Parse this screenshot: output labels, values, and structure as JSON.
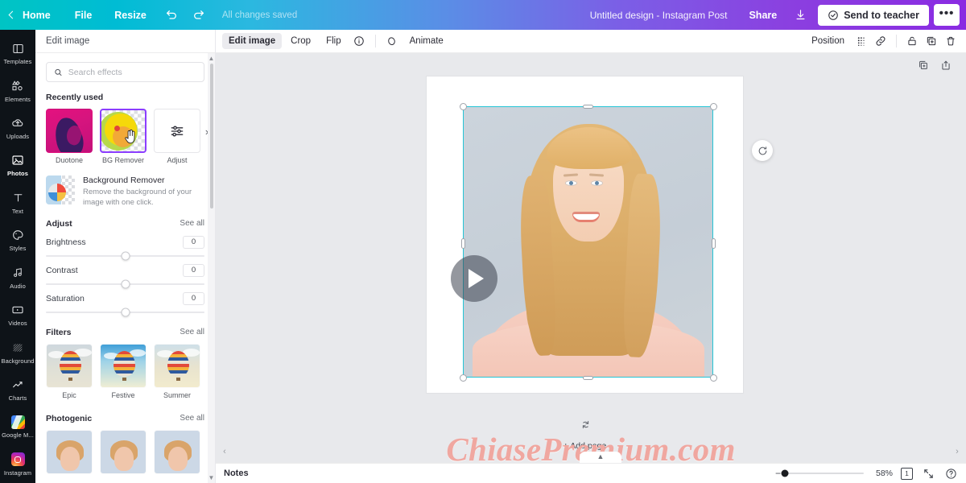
{
  "topbar": {
    "home": "Home",
    "file": "File",
    "resize": "Resize",
    "undo_icon": "undo-icon",
    "redo_icon": "redo-icon",
    "saved_status": "All changes saved",
    "doc_title": "Untitled design - Instagram Post",
    "share": "Share",
    "download_icon": "download-icon",
    "send_to_teacher": "Send to teacher",
    "more": "•••"
  },
  "rail": {
    "items": [
      {
        "label": "Templates",
        "icon": "templates-icon"
      },
      {
        "label": "Elements",
        "icon": "elements-icon"
      },
      {
        "label": "Uploads",
        "icon": "uploads-icon"
      },
      {
        "label": "Photos",
        "icon": "photos-icon",
        "active": true
      },
      {
        "label": "Text",
        "icon": "text-icon"
      },
      {
        "label": "Styles",
        "icon": "styles-icon"
      },
      {
        "label": "Audio",
        "icon": "audio-icon"
      },
      {
        "label": "Videos",
        "icon": "videos-icon"
      },
      {
        "label": "Background",
        "icon": "background-icon"
      },
      {
        "label": "Charts",
        "icon": "charts-icon"
      },
      {
        "label": "Google M...",
        "icon": "google-maps-icon"
      },
      {
        "label": "Instagram",
        "icon": "instagram-icon"
      }
    ]
  },
  "panel": {
    "title": "Edit image",
    "search_placeholder": "Search effects",
    "recently_used_title": "Recently used",
    "recent": [
      {
        "label": "Duotone"
      },
      {
        "label": "BG Remover"
      },
      {
        "label": "Adjust"
      }
    ],
    "bg_remover": {
      "title": "Background Remover",
      "desc": "Remove the background of your image with one click."
    },
    "adjust": {
      "title": "Adjust",
      "see_all": "See all",
      "sliders": [
        {
          "name": "Brightness",
          "value": "0"
        },
        {
          "name": "Contrast",
          "value": "0"
        },
        {
          "name": "Saturation",
          "value": "0"
        }
      ]
    },
    "filters": {
      "title": "Filters",
      "see_all": "See all",
      "items": [
        {
          "label": "Epic"
        },
        {
          "label": "Festive"
        },
        {
          "label": "Summer"
        }
      ]
    },
    "photogenic": {
      "title": "Photogenic",
      "see_all": "See all"
    }
  },
  "context_bar": {
    "edit_image": "Edit image",
    "crop": "Crop",
    "flip": "Flip",
    "info_icon": "info-icon",
    "animate": "Animate",
    "animate_icon": "animate-icon",
    "position": "Position",
    "transparency_icon": "transparency-icon",
    "link_icon": "link-icon",
    "lock_icon": "lock-icon",
    "duplicate_icon": "duplicate-icon",
    "delete_icon": "trash-icon"
  },
  "canvas": {
    "duplicate_page_icon": "duplicate-page-icon",
    "export_page_icon": "export-page-icon",
    "rotate_icon": "rotate-icon",
    "flip_icon": "flip-vertical-icon",
    "play_icon": "play-icon",
    "add_page": "+ Add page",
    "watermark": "ChiasePremium.com"
  },
  "statusbar": {
    "notes": "Notes",
    "zoom_value": "58%",
    "page_count": "1",
    "expand_icon": "expand-icon",
    "help_icon": "help-icon"
  },
  "colors": {
    "accent_purple": "#8b3dff",
    "selection_cyan": "#25c5d6",
    "rail_bg": "#0e1318"
  }
}
